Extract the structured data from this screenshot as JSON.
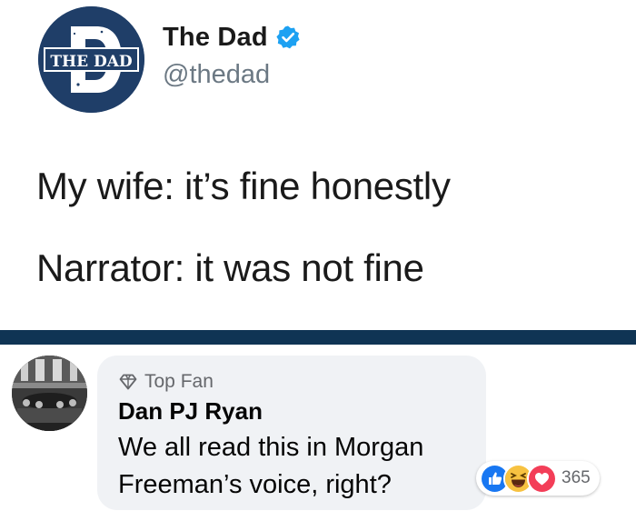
{
  "tweet": {
    "display_name": "The Dad",
    "handle": "@thedad",
    "avatar_text": "THE DAD",
    "avatar_icon": "the-dad-logo",
    "verified_icon": "verified-badge-icon",
    "lines": [
      "My wife: it’s fine honestly",
      "Narrator: it was not fine"
    ]
  },
  "comment": {
    "badge": "Top Fan",
    "badge_icon": "diamond-icon",
    "author": "Dan PJ Ryan",
    "text_lines": [
      "We all read this in Morgan",
      "Freeman’s voice, right?"
    ],
    "reactions": {
      "icons": [
        "like-icon",
        "haha-icon",
        "love-icon"
      ],
      "count": "365"
    }
  },
  "colors": {
    "brand_navy": "#1f3e68",
    "divider": "#0f3454",
    "verified_blue": "#1da1f2",
    "like_blue": "#1877f2",
    "love_red": "#f33e58",
    "haha_yellow": "#f7c241",
    "bubble_gray": "#f0f2f5"
  }
}
